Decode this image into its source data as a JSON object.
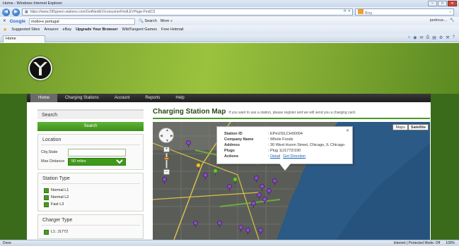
{
  "browser": {
    "title": "Home - Windows Internet Explorer",
    "url": "https://www.295green-stations.com/GetNextEV/consumerFindLEVPage-FindCS",
    "search_engine": "Bing",
    "google": {
      "logo": "Google",
      "query": "mobi+e portugal",
      "search_label": "Search",
      "more_label": "More »",
      "signin": "pedrouc..."
    },
    "favorites": [
      "Suggested Sites",
      "Amazon",
      "eBay",
      "Upgrade Your Browser",
      "WildTangent Games",
      "Free Hotmail"
    ],
    "tab_label": "Home",
    "status_left": "Done",
    "status_zone": "Internet | Protected Mode: Off",
    "status_zoom": "100%"
  },
  "site": {
    "nav": [
      "Home",
      "Charging Stations",
      "Account",
      "Reports",
      "Help"
    ]
  },
  "sidebar": {
    "search_heading": "Search",
    "search_button": "Search",
    "location_heading": "Location",
    "city_label": "City,State",
    "city_value": "",
    "distance_label": "Max Distance",
    "distance_value": "50 miles",
    "station_type_heading": "Station Type",
    "station_types": [
      "Normal L1",
      "Normal L2",
      "Fast L3"
    ],
    "charger_type_heading": "Charger Type",
    "charger_types": [
      "L1: J1772"
    ]
  },
  "main": {
    "title": "Charging Station Map",
    "note": "If you want to use a station, please register and we will send you a charging card.",
    "map_types": [
      "Maps",
      "Satellite"
    ],
    "info": {
      "station_id_label": "Station ID",
      "station_id": ": EPeUSILCH00004",
      "company_label": "Company Name",
      "company": ": Whole Foods",
      "address_label": "Address",
      "address": ": 30 West Huron Street, Chicago, IL Chicago",
      "plugs_label": "Plugs",
      "plugs": ": Plug 1(J1772/190",
      "actions_label": "Actions",
      "action_detail": "Detail",
      "action_directions": "Get Direction"
    }
  }
}
